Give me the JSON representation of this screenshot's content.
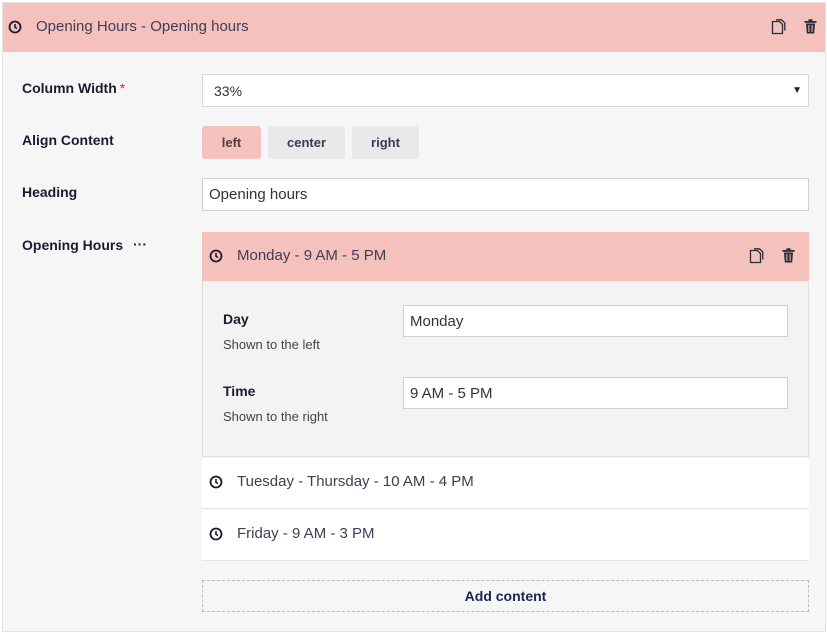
{
  "header": {
    "title": "Opening Hours - Opening hours",
    "icon": "clock-icon"
  },
  "fields": {
    "column_width": {
      "label": "Column Width",
      "required_mark": "*",
      "value": "33%"
    },
    "align_content": {
      "label": "Align Content",
      "options": [
        "left",
        "center",
        "right"
      ],
      "selected": "left"
    },
    "heading": {
      "label": "Heading",
      "value": "Opening hours"
    },
    "opening_hours": {
      "label": "Opening Hours",
      "more": "···"
    }
  },
  "items": [
    {
      "title": "Monday - 9 AM - 5 PM",
      "expanded": true,
      "day": {
        "label": "Day",
        "description": "Shown to the left",
        "value": "Monday"
      },
      "time": {
        "label": "Time",
        "description": "Shown to the right",
        "value": "9 AM - 5 PM"
      }
    },
    {
      "title": "Tuesday - Thursday - 10 AM - 4 PM",
      "expanded": false
    },
    {
      "title": "Friday - 9 AM - 3 PM",
      "expanded": false
    }
  ],
  "add_content_label": "Add content",
  "colors": {
    "accent": "#f5c1bd",
    "text": "#1b264f",
    "required": "#d42054"
  }
}
